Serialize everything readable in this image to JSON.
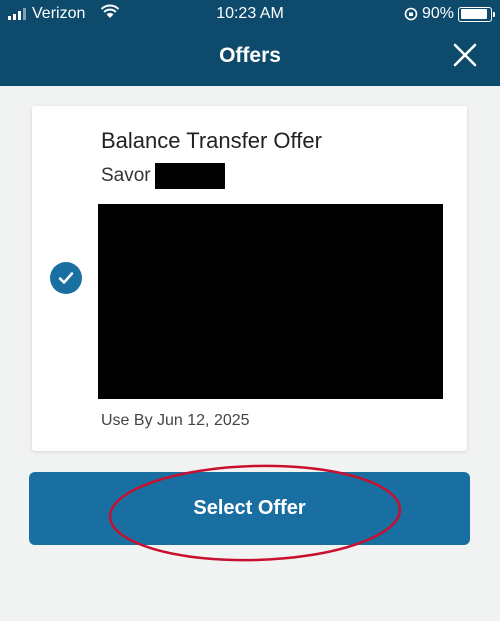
{
  "status_bar": {
    "carrier": "Verizon",
    "time": "10:23 AM",
    "battery": "90%",
    "battery_level": 0.9
  },
  "header": {
    "title": "Offers",
    "close_icon": "close-icon"
  },
  "offer_card": {
    "title": "Balance Transfer Offer",
    "product": "Savor",
    "use_by": "Use By Jun 12, 2025",
    "selected": true
  },
  "primary_action": {
    "label": "Select Offer"
  },
  "colors": {
    "header_bg": "#0d4a6b",
    "accent": "#1a6fa2",
    "annotation": "#c8102e"
  }
}
